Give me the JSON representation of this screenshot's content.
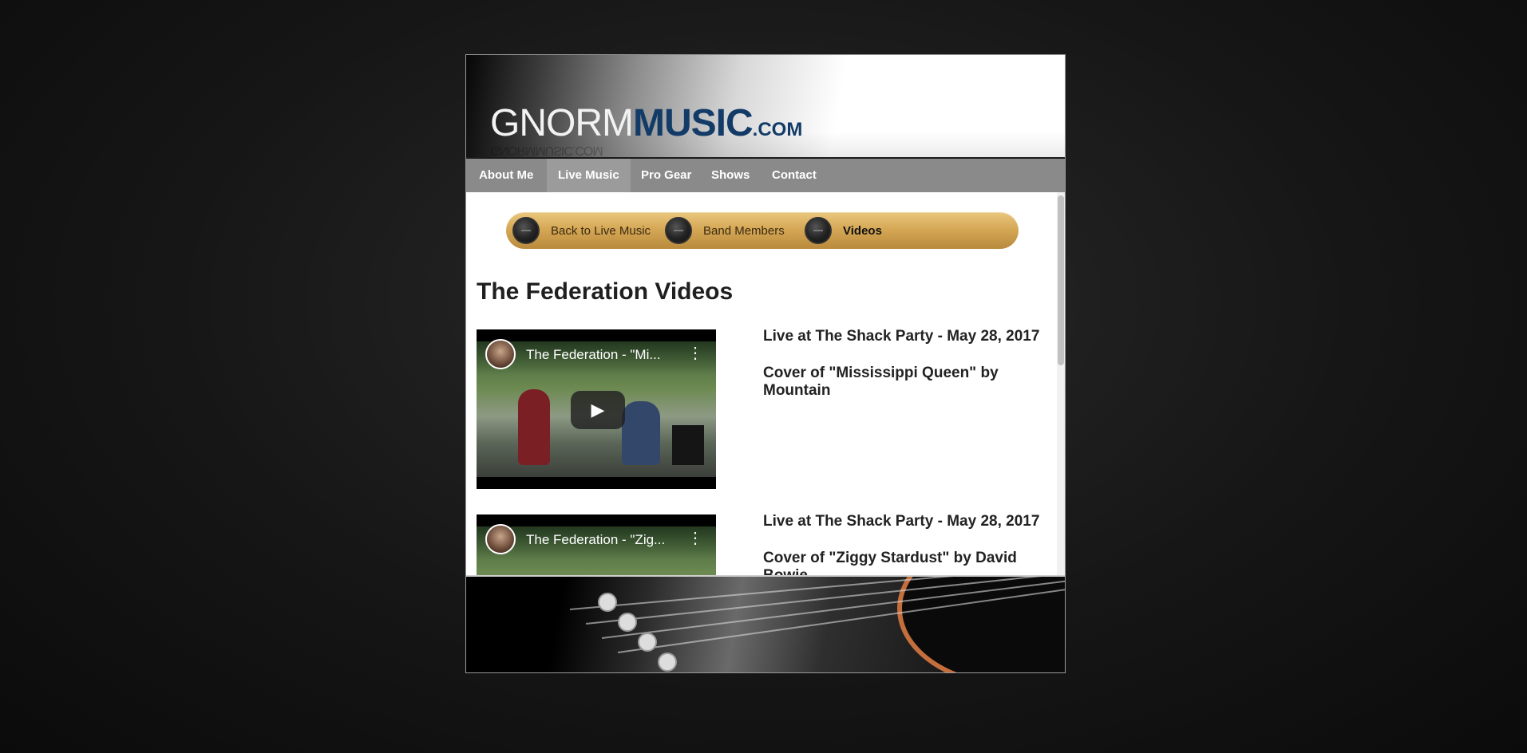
{
  "site": {
    "logo_part1": "GNORM",
    "logo_part2": "MUSIC",
    "logo_part3": ".COM"
  },
  "nav": {
    "items": [
      {
        "label": "About Me"
      },
      {
        "label": "Live Music"
      },
      {
        "label": "Pro Gear"
      },
      {
        "label": "Shows"
      },
      {
        "label": "Contact"
      }
    ],
    "active": "Live Music"
  },
  "subnav": {
    "items": [
      {
        "label": "Back to Live Music"
      },
      {
        "label": "Band Members"
      },
      {
        "label": "Videos"
      }
    ],
    "current": "Videos"
  },
  "page": {
    "title": "The Federation Videos"
  },
  "videos": [
    {
      "title": "The Federation - \"Mi...",
      "event": "Live at The Shack Party - May 28, 2017",
      "description": "Cover of \"Mississippi Queen\" by Mountain"
    },
    {
      "title": "The Federation - \"Zig...",
      "event": "Live at The Shack Party - May 28, 2017",
      "description": "Cover of \"Ziggy Stardust\" by David Bowie"
    }
  ],
  "colors": {
    "nav_bg": "#8a8a8a",
    "logo_accent": "#133b68",
    "subnav_gold": "#d5a856",
    "page_bg": "#161616"
  }
}
